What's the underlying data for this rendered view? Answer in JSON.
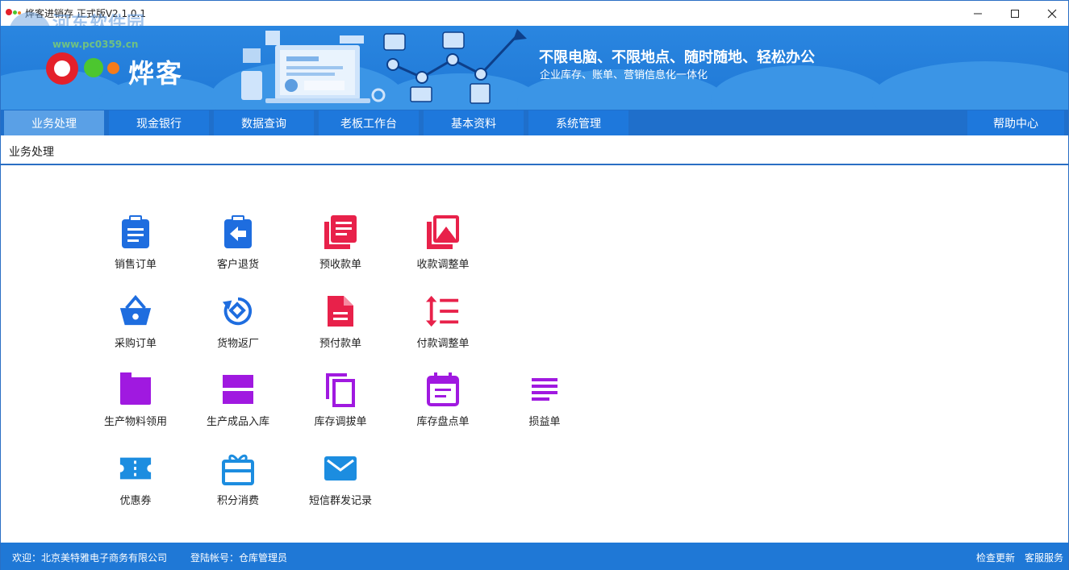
{
  "window": {
    "title": "烨客进销存   正式版V2.1.0.1",
    "watermark_name": "河东软件园",
    "watermark_url": "www.pc0359.cn"
  },
  "banner": {
    "logo_text": "烨客",
    "slogan": "不限电脑、不限地点、随时随地、轻松办公",
    "subslogan": "企业库存、账单、营销信息化一体化"
  },
  "tabs": [
    {
      "label": "业务处理",
      "active": true
    },
    {
      "label": "现金银行"
    },
    {
      "label": "数据查询"
    },
    {
      "label": "老板工作台"
    },
    {
      "label": "基本资料"
    },
    {
      "label": "系统管理"
    }
  ],
  "help_tab": "帮助中心",
  "breadcrumb": "业务处理",
  "tiles": [
    {
      "label": "销售订单",
      "icon": "clipboard-list-icon",
      "color": "#1e6ddf"
    },
    {
      "label": "客户退货",
      "icon": "clipboard-return-icon",
      "color": "#1e6ddf"
    },
    {
      "label": "预收款单",
      "icon": "receipt-stack-icon",
      "color": "#e8214a"
    },
    {
      "label": "收款调整单",
      "icon": "image-plus-icon",
      "color": "#e8214a"
    },
    {
      "label": "采购订单",
      "icon": "basket-icon",
      "color": "#1e6ddf"
    },
    {
      "label": "货物返厂",
      "icon": "rotate-diamond-icon",
      "color": "#1e6ddf"
    },
    {
      "label": "预付款单",
      "icon": "document-icon",
      "color": "#e8214a"
    },
    {
      "label": "付款调整单",
      "icon": "sort-lines-icon",
      "color": "#e8214a"
    },
    {
      "label": "生产物料领用",
      "icon": "folder-icon",
      "color": "#a019e0"
    },
    {
      "label": "生产成品入库",
      "icon": "split-box-icon",
      "color": "#a019e0"
    },
    {
      "label": "库存调拔单",
      "icon": "copy-icon",
      "color": "#a019e0"
    },
    {
      "label": "库存盘点单",
      "icon": "calendar-icon",
      "color": "#a019e0"
    },
    {
      "label": "损益单",
      "icon": "align-left-icon",
      "color": "#a019e0"
    },
    {
      "label": "优惠券",
      "icon": "ticket-icon",
      "color": "#1c8de0"
    },
    {
      "label": "积分消费",
      "icon": "gift-icon",
      "color": "#1c8de0"
    },
    {
      "label": "短信群发记录",
      "icon": "mail-icon",
      "color": "#1c8de0"
    }
  ],
  "status": {
    "welcome": "欢迎：北京美特雅电子商务有限公司",
    "account": "登陆帐号：仓库管理员",
    "check_update": "检查更新",
    "customer_service": "客服服务"
  }
}
